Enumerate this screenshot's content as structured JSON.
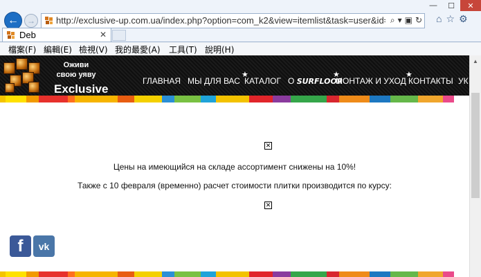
{
  "browser": {
    "url": "http://exclusive-up.com.ua/index.php?option=com_k2&view=itemlist&task=user&id=",
    "tab_title": "Deb",
    "tab_close": "✕",
    "window": {
      "minimize": "—",
      "maximize": "☐",
      "close": "✕"
    },
    "menu": [
      "檔案(F)",
      "編輯(E)",
      "檢視(V)",
      "我的最愛(A)",
      "工具(T)",
      "說明(H)"
    ]
  },
  "site": {
    "slogan": "Оживи свою уяву",
    "brand": "Exclusive",
    "nav": [
      {
        "label": "ГЛАВНАЯ"
      },
      {
        "label": "МЫ ДЛЯ ВАС"
      },
      {
        "label": "КАТАЛОГ"
      },
      {
        "label": "О"
      },
      {
        "label": "SURFLOOR"
      },
      {
        "label": "МОНТАЖ И УХОД"
      },
      {
        "label": "КОНТАКТЫ"
      },
      {
        "label": "УК"
      }
    ],
    "notice_line1": "Цены на имеющийся на складе ассортимент снижены на 10%!",
    "notice_line2": "Также с 10 февраля (временно) расчет стоимости плитки производится по курсу:",
    "social": {
      "facebook": "f",
      "vk": "vk"
    }
  },
  "colors": {
    "back_button": "#1d6ec4",
    "header_bg": "#131313",
    "close_button": "#c7463a",
    "facebook": "#3b5998",
    "vk": "#4a76a8"
  }
}
